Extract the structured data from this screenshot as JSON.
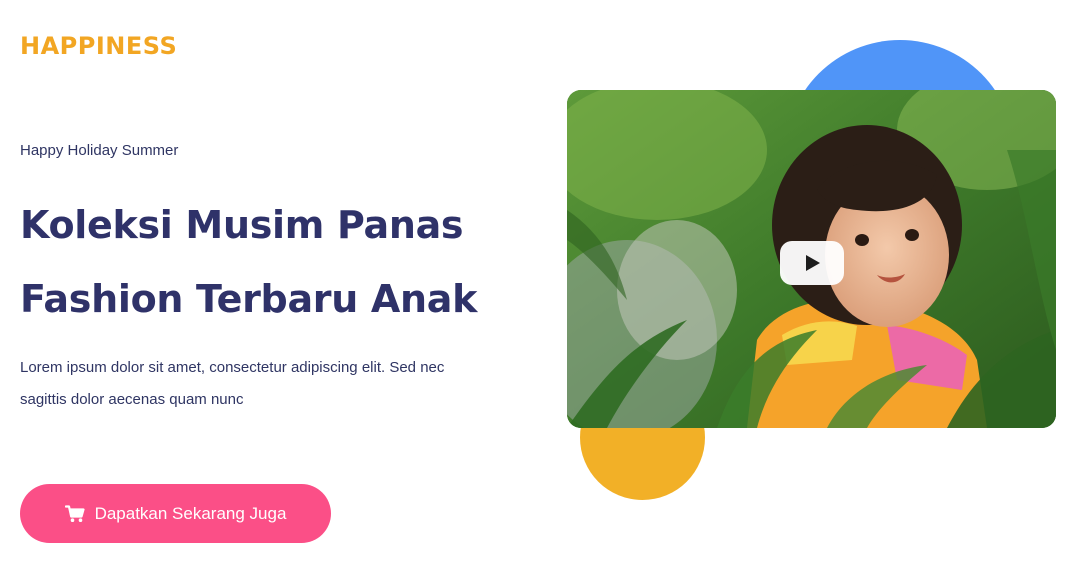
{
  "brand": {
    "name": "HAPPINESS"
  },
  "hero": {
    "eyebrow": "Happy Holiday Summer",
    "headline_line1": "Koleksi Musim Panas",
    "headline_line2": "Fashion Terbaru Anak",
    "description": "Lorem ipsum dolor sit amet, consectetur adipiscing elit. Sed nec sagittis dolor aecenas quam nunc",
    "cta_label": "Dapatkan Sekarang Juga",
    "cta_icon": "cart-icon"
  },
  "media": {
    "play_icon": "play-icon",
    "image_subject": "child-in-garden-photo"
  },
  "colors": {
    "brand": "#f2a623",
    "headline": "#2f3269",
    "body_text": "#2f3563",
    "cta": "#fb4f87",
    "blue_shape": "#5095f8",
    "yellow_shape": "#f2b027"
  }
}
